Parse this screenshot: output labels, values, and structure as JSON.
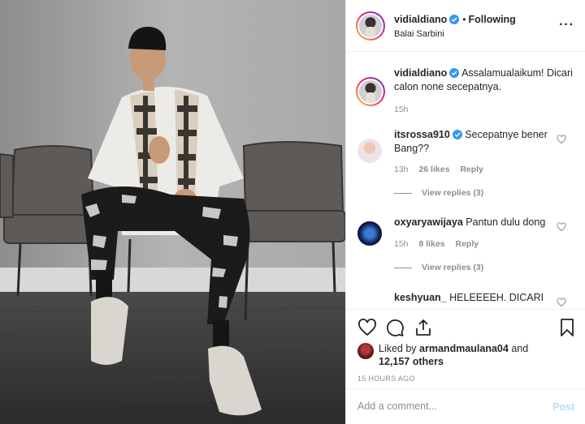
{
  "post": {
    "author": "vidialdiano",
    "follow_status": "Following",
    "location": "Balai Sarbini"
  },
  "caption": {
    "username": "vidialdiano",
    "text": "Assalamualaikum! Dicari calon none secepatnya.",
    "time": "15h"
  },
  "comments": [
    {
      "username": "itsrossa910",
      "text": "Secepatnye bener Bang??",
      "time": "13h",
      "likes": "26 likes",
      "reply": "Reply",
      "view_replies": "View replies (3)"
    },
    {
      "username": "oxyaryawijaya",
      "text": "Pantun dulu dong",
      "time": "15h",
      "likes": "8 likes",
      "reply": "Reply",
      "view_replies": "View replies (3)"
    },
    {
      "username": "keshyuan_",
      "text": "HELEEEEH. DICARI"
    }
  ],
  "likes_summary": {
    "prefix": "Liked by",
    "user": "armandmaulana04",
    "connector": "and",
    "others": "12,157 others"
  },
  "timestamp": "15 HOURS AGO",
  "add_comment": {
    "placeholder": "Add a comment...",
    "post_label": "Post"
  },
  "colors": {
    "verified": "#3897f0",
    "post_disabled": "#b2dffc",
    "muted": "#8e8e8e"
  }
}
